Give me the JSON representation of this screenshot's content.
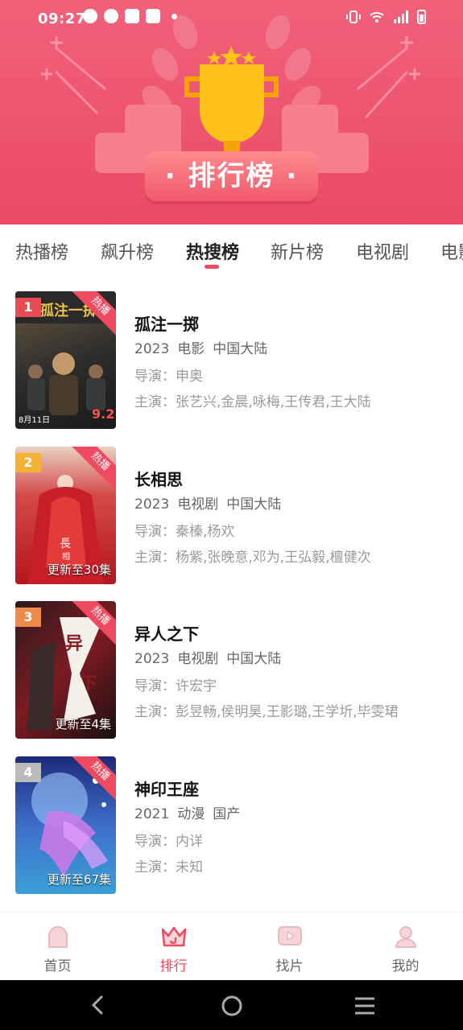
{
  "status_bar": {
    "time": "09:27"
  },
  "banner": {
    "title": "· 排行榜 ·"
  },
  "tabs": [
    {
      "label": "热播榜",
      "active": false
    },
    {
      "label": "飙升榜",
      "active": false
    },
    {
      "label": "热搜榜",
      "active": true
    },
    {
      "label": "新片榜",
      "active": false
    },
    {
      "label": "电视剧",
      "active": false
    },
    {
      "label": "电影",
      "active": false
    }
  ],
  "items": [
    {
      "rank": "1",
      "badge": "热播",
      "update": "",
      "title": "孤注一掷",
      "year": "2023",
      "type": "电影",
      "region": "中国大陆",
      "director": "导演：申奥",
      "actors": "主演：张艺兴,金晨,咏梅,王传君,王大陆",
      "rank_color": "#e94b52",
      "poster_colors": [
        "#3a3a3a",
        "#9a7a50"
      ]
    },
    {
      "rank": "2",
      "badge": "热播",
      "update": "更新至30集",
      "title": "长相思",
      "year": "2023",
      "type": "电视剧",
      "region": "中国大陆",
      "director": "导演：秦榛,杨欢",
      "actors": "主演：杨紫,张晚意,邓为,王弘毅,檀健次",
      "rank_color": "#f2b233",
      "poster_colors": [
        "#e8c8b8",
        "#b3161e"
      ]
    },
    {
      "rank": "3",
      "badge": "热播",
      "update": "更新至4集",
      "title": "异人之下",
      "year": "2023",
      "type": "电视剧",
      "region": "中国大陆",
      "director": "导演：许宏宇",
      "actors": "主演：彭昱畅,侯明昊,王影璐,王学圻,毕雯珺",
      "rank_color": "#f08a4b",
      "poster_colors": [
        "#1c1416",
        "#8a1c22"
      ]
    },
    {
      "rank": "4",
      "badge": "热播",
      "update": "更新至67集",
      "title": "神印王座",
      "year": "2021",
      "type": "动漫",
      "region": "国产",
      "director": "导演：内详",
      "actors": "主演：未知",
      "rank_color": "#bbbbbb",
      "poster_colors": [
        "#2a2f8a",
        "#3aa0d8"
      ]
    }
  ],
  "bottom_nav": [
    {
      "label": "首页",
      "icon": "home-icon",
      "active": false
    },
    {
      "label": "排行",
      "icon": "crown-icon",
      "active": true
    },
    {
      "label": "找片",
      "icon": "video-icon",
      "active": false
    },
    {
      "label": "我的",
      "icon": "user-icon",
      "active": false
    }
  ],
  "colors": {
    "accent": "#ef4a60",
    "banner": "#ea4f69"
  }
}
